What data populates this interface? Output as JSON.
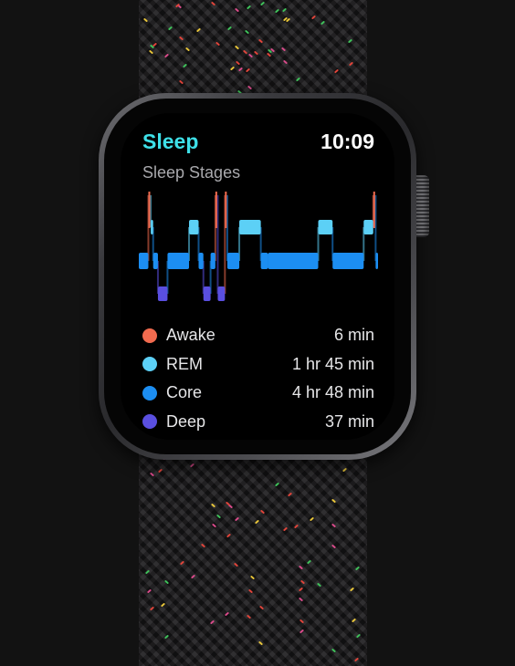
{
  "app": {
    "title": "Sleep",
    "time": "10:09",
    "subtitle": "Sleep Stages"
  },
  "colors": {
    "accent": "#3ee0e8",
    "awake": "#f26b4f",
    "rem": "#5cd0f6",
    "core": "#1c8ef2",
    "deep": "#5a4fe0"
  },
  "legend": [
    {
      "stage": "Awake",
      "duration": "6 min",
      "color": "#f26b4f"
    },
    {
      "stage": "REM",
      "duration": "1 hr 45 min",
      "color": "#5cd0f6"
    },
    {
      "stage": "Core",
      "duration": "4 hr 48 min",
      "color": "#1c8ef2"
    },
    {
      "stage": "Deep",
      "duration": "37 min",
      "color": "#5a4fe0"
    }
  ],
  "chart_data": {
    "type": "bar",
    "title": "Sleep Stages",
    "categories": [
      "Awake",
      "REM",
      "Core",
      "Deep"
    ],
    "stages": [
      "Awake",
      "REM",
      "Core",
      "Deep"
    ],
    "segments": [
      {
        "stage": "Core",
        "start": 0.0,
        "end": 0.04
      },
      {
        "stage": "Awake",
        "start": 0.04,
        "end": 0.05
      },
      {
        "stage": "REM",
        "start": 0.05,
        "end": 0.06
      },
      {
        "stage": "Core",
        "start": 0.06,
        "end": 0.08
      },
      {
        "stage": "Deep",
        "start": 0.08,
        "end": 0.12
      },
      {
        "stage": "Core",
        "start": 0.12,
        "end": 0.21
      },
      {
        "stage": "REM",
        "start": 0.21,
        "end": 0.25
      },
      {
        "stage": "Core",
        "start": 0.25,
        "end": 0.27
      },
      {
        "stage": "Deep",
        "start": 0.27,
        "end": 0.3
      },
      {
        "stage": "Core",
        "start": 0.3,
        "end": 0.32
      },
      {
        "stage": "Awake",
        "start": 0.32,
        "end": 0.33
      },
      {
        "stage": "Deep",
        "start": 0.33,
        "end": 0.36
      },
      {
        "stage": "Awake",
        "start": 0.36,
        "end": 0.37
      },
      {
        "stage": "Core",
        "start": 0.37,
        "end": 0.42
      },
      {
        "stage": "REM",
        "start": 0.42,
        "end": 0.51
      },
      {
        "stage": "Core",
        "start": 0.51,
        "end": 0.54
      },
      {
        "stage": "Core",
        "start": 0.54,
        "end": 0.75
      },
      {
        "stage": "REM",
        "start": 0.75,
        "end": 0.81
      },
      {
        "stage": "Core",
        "start": 0.81,
        "end": 0.94
      },
      {
        "stage": "REM",
        "start": 0.94,
        "end": 0.98
      },
      {
        "stage": "Awake",
        "start": 0.98,
        "end": 0.99
      },
      {
        "stage": "Core",
        "start": 0.99,
        "end": 1.0
      }
    ],
    "values": [
      6,
      105,
      288,
      37
    ],
    "units": "min"
  }
}
